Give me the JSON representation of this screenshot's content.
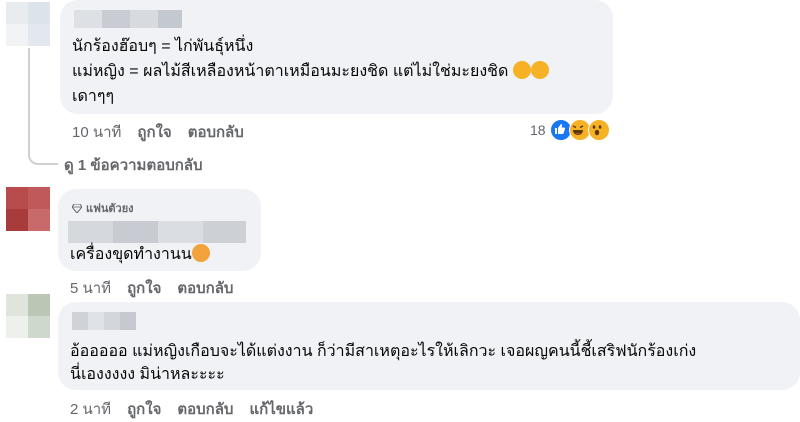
{
  "comments": [
    {
      "lines": [
        "นักร้องฮ๊อบๆ = ไก่พันธุ์หนึ่ง",
        "แม่หญิง = ผลไม้สีเหลืองหน้าตาเหมือนมะยงชิด แต่ไม่ใช่มะยงชิด",
        "เดาๆๆ"
      ],
      "time": "10 นาที",
      "like_label": "ถูกใจ",
      "reply_label": "ตอบกลับ",
      "reaction_count": "18"
    },
    {
      "view_replies": "ดู 1 ข้อความตอบกลับ"
    },
    {
      "badge": "แฟนตัวยง",
      "text": "เครื่องขุดทำงานน",
      "time": "5 นาที",
      "like_label": "ถูกใจ",
      "reply_label": "ตอบกลับ"
    },
    {
      "lines": [
        "อ้อออออ แม่หญิงเกือบจะได้แต่งงาน ก็ว่ามีสาเหตุอะไรให้เลิกวะ เจอผญคนนี้ชี้เสริฟนักร้องเก่ง",
        "นี่เองงงงง มิน่าหละะะะ"
      ],
      "time": "2 นาที",
      "like_label": "ถูกใจ",
      "reply_label": "ตอบกลับ",
      "edited_label": "แก้ไขแล้ว"
    }
  ],
  "colors": {
    "bubble": "#f0f2f5",
    "meta_text": "#65676b",
    "like_blue": "#1877f2",
    "emoji_yellow": "#f7b125"
  }
}
